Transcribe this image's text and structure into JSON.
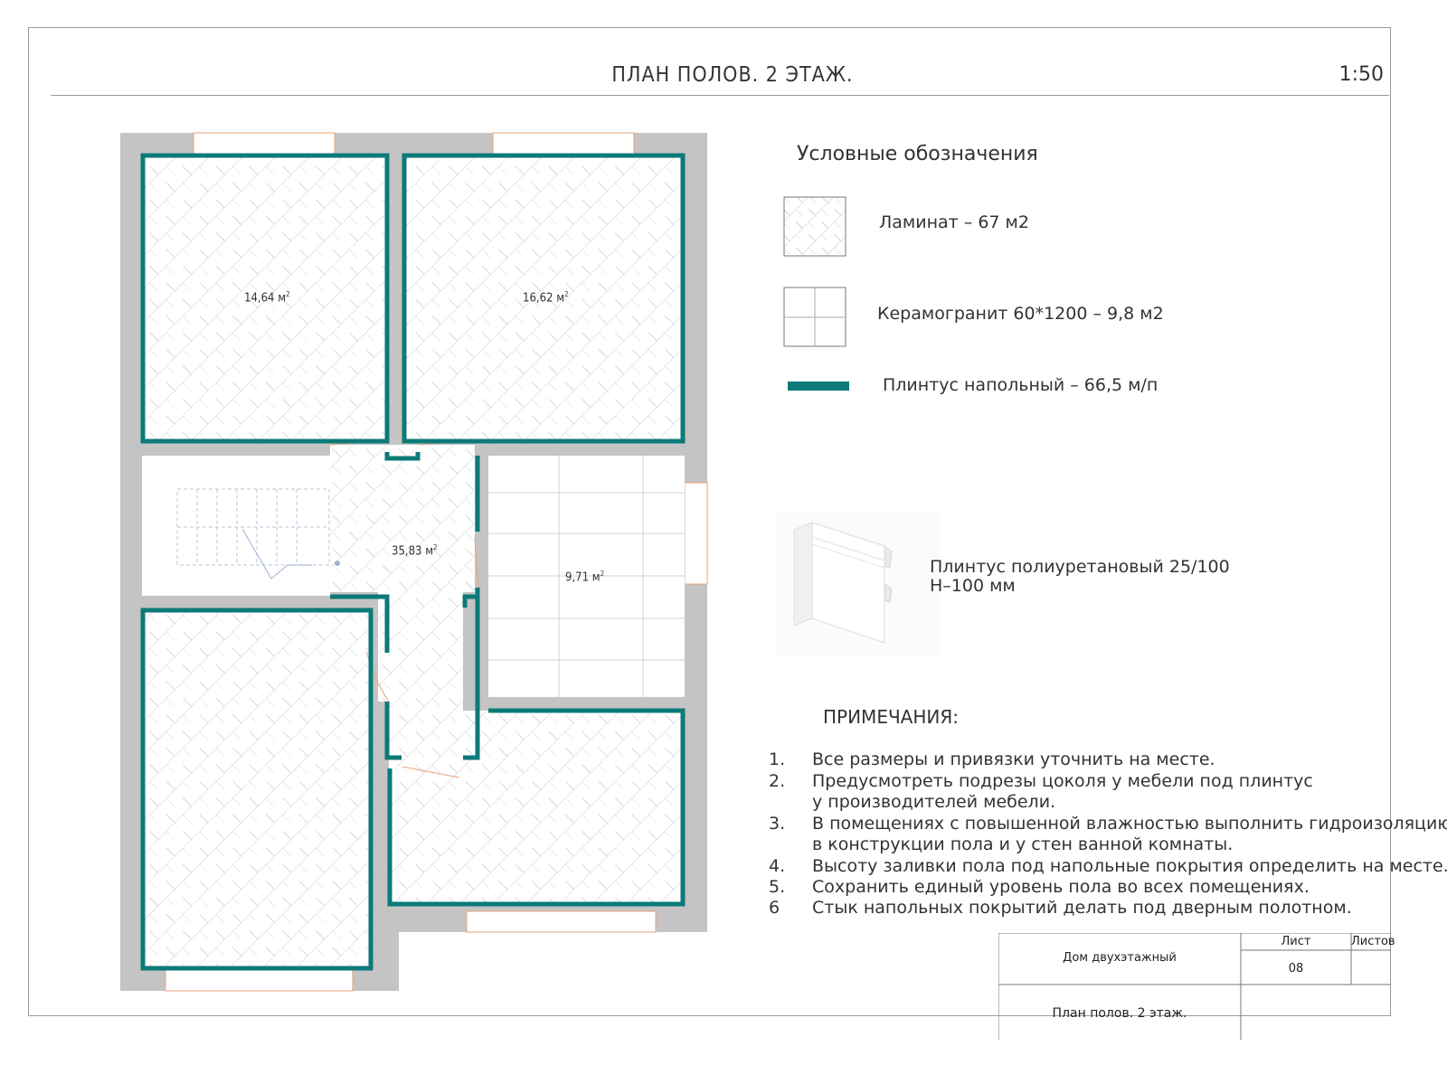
{
  "sheet": {
    "title": "ПЛАН ПОЛОВ. 2 ЭТАЖ.",
    "scale": "1:50"
  },
  "rooms": [
    {
      "area": "14,64",
      "unit": "м",
      "sup": "2"
    },
    {
      "area": "16,62",
      "unit": "м",
      "sup": "2"
    },
    {
      "area": "35,83",
      "unit": "м",
      "sup": "2"
    },
    {
      "area": "9,71",
      "unit": "м",
      "sup": "2"
    }
  ],
  "legend": {
    "title": "Условные обозначения",
    "items": [
      {
        "label": "Ламинат – 67 м2",
        "icon": "laminate-hatch"
      },
      {
        "label": "Керамогранит 60*1200  – 9,8 м2",
        "icon": "tile-grid"
      },
      {
        "label": "Плинтус напольный – 66,5 м/п",
        "icon": "skirting-line"
      }
    ],
    "skirting_color": "#0b7a78"
  },
  "product": {
    "line1": "Плинтус полиуретановый 25/100",
    "line2": "Н–100 мм"
  },
  "notes": {
    "title": "ПРИМЕЧАНИЯ:",
    "items": [
      {
        "num": "1.",
        "text": "Все размеры и привязки уточнить на месте."
      },
      {
        "num": "2.",
        "text": "Предусмотреть подрезы цоколя у мебели под плинтус",
        "cont": "у производителей мебели."
      },
      {
        "num": "3.",
        "text": "В помещениях с повышенной влажностью выполнить гидроизоляцию",
        "cont": "в конструкции пола и у стен ванной комнаты."
      },
      {
        "num": "4.",
        "text": "Высоту заливки пола под напольные покрытия определить на месте."
      },
      {
        "num": "5.",
        "text": "Сохранить единый уровень пола во всех помещениях."
      },
      {
        "num": "6",
        "text": "Стык напольных покрытий делать под дверным полотном."
      }
    ]
  },
  "stamp": {
    "project": "Дом двухэтажный",
    "sheet_label": "Лист",
    "sheets_label": "Листов",
    "sheet_number": "08",
    "sheets_total": "",
    "drawing_name": "План полов. 2 этаж."
  },
  "colors": {
    "wall": "#c4c4c4",
    "skirting": "#0b7a78",
    "hatch": "#c9c9c9",
    "door": "#e3a57a"
  }
}
